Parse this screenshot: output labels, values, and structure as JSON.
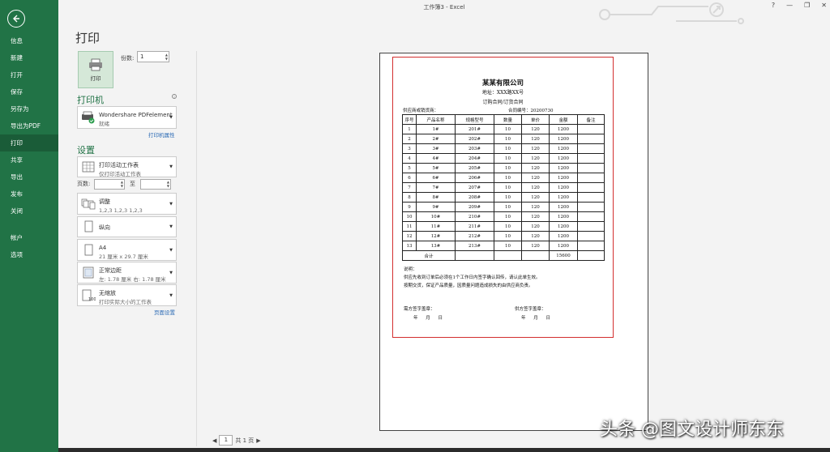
{
  "window": {
    "title": "工作簿3 - Excel",
    "help": "?",
    "minimize": "—",
    "restore": "❐",
    "close": "✕"
  },
  "sidebar": {
    "items": [
      {
        "label": "信息"
      },
      {
        "label": "新建"
      },
      {
        "label": "打开"
      },
      {
        "label": "保存"
      },
      {
        "label": "另存为"
      },
      {
        "label": "导出为PDF"
      },
      {
        "label": "打印"
      },
      {
        "label": "共享"
      },
      {
        "label": "导出"
      },
      {
        "label": "发布"
      },
      {
        "label": "关闭"
      },
      {
        "label": "帐户"
      },
      {
        "label": "选项"
      }
    ],
    "active": "打印"
  },
  "print": {
    "title": "打印",
    "button_label": "打印",
    "copies_label": "份数:",
    "copies_value": "1",
    "printer_head": "打印机",
    "printer_name": "Wondershare PDFelement",
    "printer_status": "就绪",
    "printer_props": "打印机属性",
    "settings_head": "设置",
    "scope_main": "打印活动工作表",
    "scope_sub": "仅打印活动工作表",
    "pages_label": "页数:",
    "pages_to": "至",
    "collate_main": "调整",
    "collate_sub": "1,2,3    1,2,3    1,2,3",
    "orientation": "纵向",
    "paper_main": "A4",
    "paper_sub": "21 厘米 x 29.7 厘米",
    "margin_main": "正常边距",
    "margin_sub": "左: 1.78 厘米    右: 1.78 厘米",
    "scale_main": "无缩放",
    "scale_sub": "打印实际大小的工作表",
    "page_setup": "页面设置"
  },
  "preview": {
    "company": "某某有限公司",
    "address": "地址：XXX路XX号",
    "doc_type": "订购合同/订货合同",
    "supplier": "供应商或销货商：",
    "contract_no": "合同编号：20200730",
    "headers": [
      "序号",
      "产品名称",
      "规格型号",
      "数量",
      "单价",
      "金额",
      "备注"
    ],
    "rows": [
      [
        "1",
        "1#",
        "201#",
        "10",
        "120",
        "1200",
        ""
      ],
      [
        "2",
        "2#",
        "202#",
        "10",
        "120",
        "1200",
        ""
      ],
      [
        "3",
        "3#",
        "203#",
        "10",
        "120",
        "1200",
        ""
      ],
      [
        "4",
        "4#",
        "204#",
        "10",
        "120",
        "1200",
        ""
      ],
      [
        "5",
        "5#",
        "205#",
        "10",
        "120",
        "1200",
        ""
      ],
      [
        "6",
        "6#",
        "206#",
        "10",
        "120",
        "1200",
        ""
      ],
      [
        "7",
        "7#",
        "207#",
        "10",
        "120",
        "1200",
        ""
      ],
      [
        "8",
        "8#",
        "208#",
        "10",
        "120",
        "1200",
        ""
      ],
      [
        "9",
        "9#",
        "209#",
        "10",
        "120",
        "1200",
        ""
      ],
      [
        "10",
        "10#",
        "210#",
        "10",
        "120",
        "1200",
        ""
      ],
      [
        "11",
        "11#",
        "211#",
        "10",
        "120",
        "1200",
        ""
      ],
      [
        "12",
        "12#",
        "212#",
        "10",
        "120",
        "1200",
        ""
      ],
      [
        "13",
        "13#",
        "213#",
        "10",
        "120",
        "1200",
        ""
      ]
    ],
    "total_label": "合计",
    "total_value": "15600",
    "notes_title": "说明：",
    "notes_line1": "供应先收到订单后必须在1个工作日内签字确认回传，请认此单生效。",
    "notes_line2": "按期交货，保证产品质量，因质量问题造成损失的由供应商负责。",
    "sign_buyer": "需方签字盖章：",
    "sign_supplier": "供方签字盖章：",
    "date_text": "年 月 日"
  },
  "page_nav": {
    "prev": "◀",
    "current": "1",
    "total": "共 1 页",
    "next": "▶"
  },
  "watermark": "头条 @图文设计师东东"
}
